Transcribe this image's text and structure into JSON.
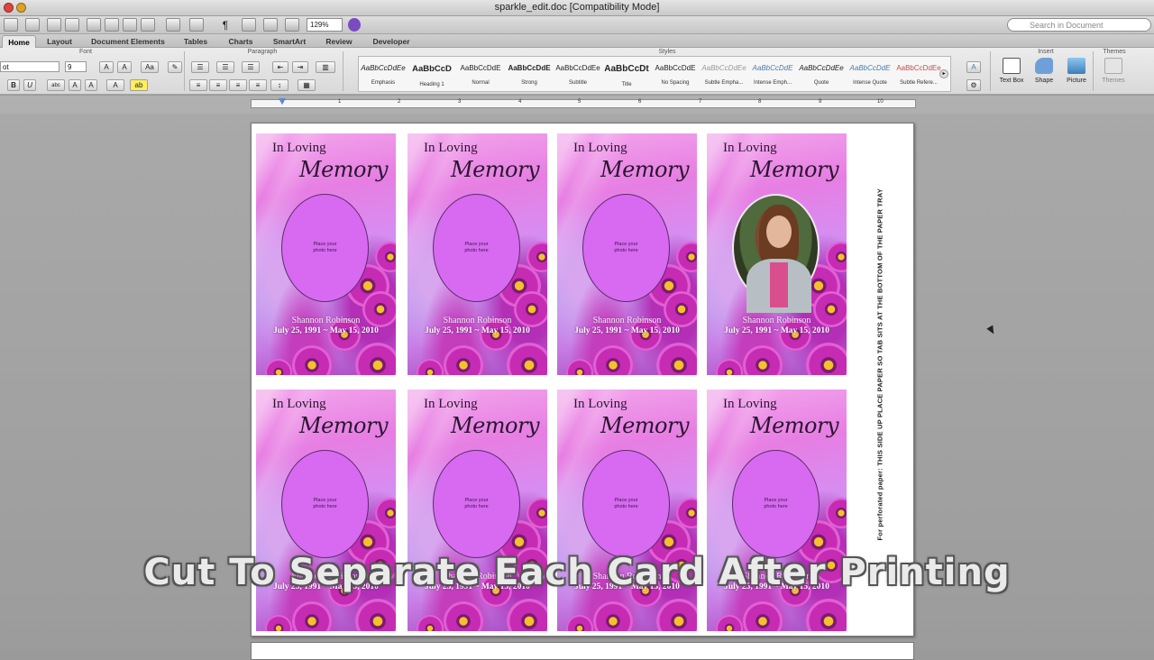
{
  "window": {
    "title": "sparkle_edit.doc [Compatibility Mode]"
  },
  "toolbar": {
    "zoom": "129%",
    "search_placeholder": "Search in Document"
  },
  "tabs": [
    "Home",
    "Layout",
    "Document Elements",
    "Tables",
    "Charts",
    "SmartArt",
    "Review",
    "Developer"
  ],
  "ribbon": {
    "group_font": "Font",
    "group_paragraph": "Paragraph",
    "group_styles": "Styles",
    "group_insert": "Insert",
    "group_themes": "Themes",
    "font_name": "ot",
    "font_size": "9",
    "styles": [
      {
        "sample": "AaBbCcDdEe",
        "name": "Emphasis",
        "color": "#333"
      },
      {
        "sample": "AaBbCcD",
        "name": "Heading 1",
        "color": "#111"
      },
      {
        "sample": "AaBbCcDdE",
        "name": "Normal",
        "color": "#333"
      },
      {
        "sample": "AaBbCcDdE",
        "name": "Strong",
        "color": "#111"
      },
      {
        "sample": "AaBbCcDdEe",
        "name": "Subtitle",
        "color": "#333"
      },
      {
        "sample": "AaBbCcDt",
        "name": "Title",
        "color": "#111"
      },
      {
        "sample": "AaBbCcDdE",
        "name": "No Spacing",
        "color": "#333"
      },
      {
        "sample": "AaBbCcDdEe",
        "name": "Subtle Empha...",
        "color": "#888"
      },
      {
        "sample": "AaBbCcDdE",
        "name": "Intense Emph...",
        "color": "#4a7ab0"
      },
      {
        "sample": "AaBbCcDdEe",
        "name": "Quote",
        "color": "#333"
      },
      {
        "sample": "AaBbCcDdE",
        "name": "Intense Quote",
        "color": "#4a7ab0"
      },
      {
        "sample": "AaBbCcDdEe",
        "name": "Subtle Refere...",
        "color": "#c0504d"
      }
    ],
    "insert": [
      {
        "name": "Text Box",
        "icon": "text-box-icon"
      },
      {
        "name": "Shape",
        "icon": "shape-icon"
      },
      {
        "name": "Picture",
        "icon": "picture-icon"
      }
    ],
    "themes_label": "Themes"
  },
  "ruler": {
    "numbers": [
      "1",
      "2",
      "3",
      "4",
      "5",
      "6",
      "7",
      "8",
      "9",
      "10"
    ]
  },
  "cards": [
    {
      "line1": "In Loving",
      "line2": "Memory",
      "placeholder": "Place your photo here",
      "name": "Shannon Robinson",
      "dates": "July 25, 1991 ~ May 15, 2010",
      "has_photo": false
    },
    {
      "line1": "In Loving",
      "line2": "Memory",
      "placeholder": "Place your photo here",
      "name": "Shannon Robinson",
      "dates": "July 25, 1991 ~ May 15, 2010",
      "has_photo": false
    },
    {
      "line1": "In Loving",
      "line2": "Memory",
      "placeholder": "Place your photo here",
      "name": "Shannon Robinson",
      "dates": "July 25, 1991 ~ May 15, 2010",
      "has_photo": false
    },
    {
      "line1": "In Loving",
      "line2": "Memory",
      "placeholder": "",
      "name": "Shannon Robinson",
      "dates": "July 25, 1991 ~ May 15, 2010",
      "has_photo": true
    },
    {
      "line1": "In Loving",
      "line2": "Memory",
      "placeholder": "Place your photo here",
      "name": "Shannon Robinson",
      "dates": "July 25, 1991 ~ May 15, 2010",
      "has_photo": false
    },
    {
      "line1": "In Loving",
      "line2": "Memory",
      "placeholder": "Place your photo here",
      "name": "Shannon Robinson",
      "dates": "July 25, 1991 ~ May 15, 2010",
      "has_photo": false
    },
    {
      "line1": "In Loving",
      "line2": "Memory",
      "placeholder": "Place your photo here",
      "name": "Shannon Robinson",
      "dates": "July 25, 1991 ~ May 15, 2010",
      "has_photo": false
    },
    {
      "line1": "In Loving",
      "line2": "Memory",
      "placeholder": "Place your photo here",
      "name": "Shannon Robinson",
      "dates": "July 25, 1991 ~ May 15, 2010",
      "has_photo": false
    }
  ],
  "side_note": "For perforated paper: THIS SIDE UP PLACE PAPER SO TAB SITS AT THE BOTTOM OF THE PAPER TRAY",
  "caption": "Cut To Separate Each Card After Printing",
  "colors": {
    "card_pink": "#e77ee3",
    "oval_fill": "#d76af1",
    "caption": "#eaeaea"
  }
}
